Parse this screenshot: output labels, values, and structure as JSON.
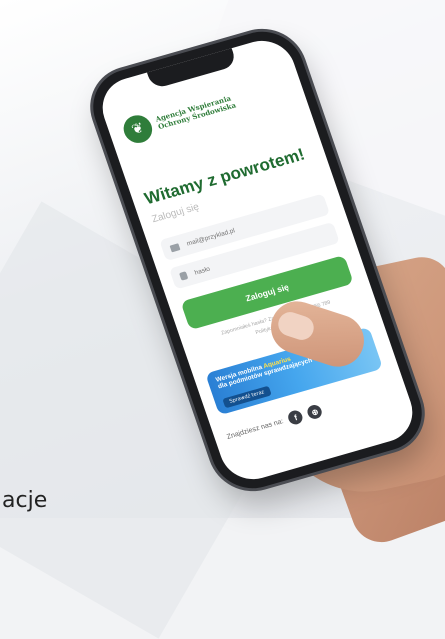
{
  "caption": "acje",
  "app": {
    "logo": {
      "line1": "Agencja Wspierania",
      "line2": "Ochrony Środowiska"
    },
    "welcome": "Witamy z powrotem!",
    "subtitle": "Zaloguj się",
    "email_placeholder": "mail@przyklad.pl",
    "password_placeholder": "hasło",
    "login_button": "Zaloguj się",
    "forgot_text": "Zapomniałeś hasła? Zadzwoń: +48 123 456 789",
    "privacy": "Polityka prywatności",
    "promo": {
      "line1_prefix": "Wersja mobilna",
      "line1_brand": "Aquarius",
      "line2": "dla podmiotów sprawdzających",
      "button": "Sprawdź teraz"
    },
    "find_us": "Znajdziesz nas na:",
    "social": {
      "facebook": "f",
      "web": "⊕"
    }
  }
}
